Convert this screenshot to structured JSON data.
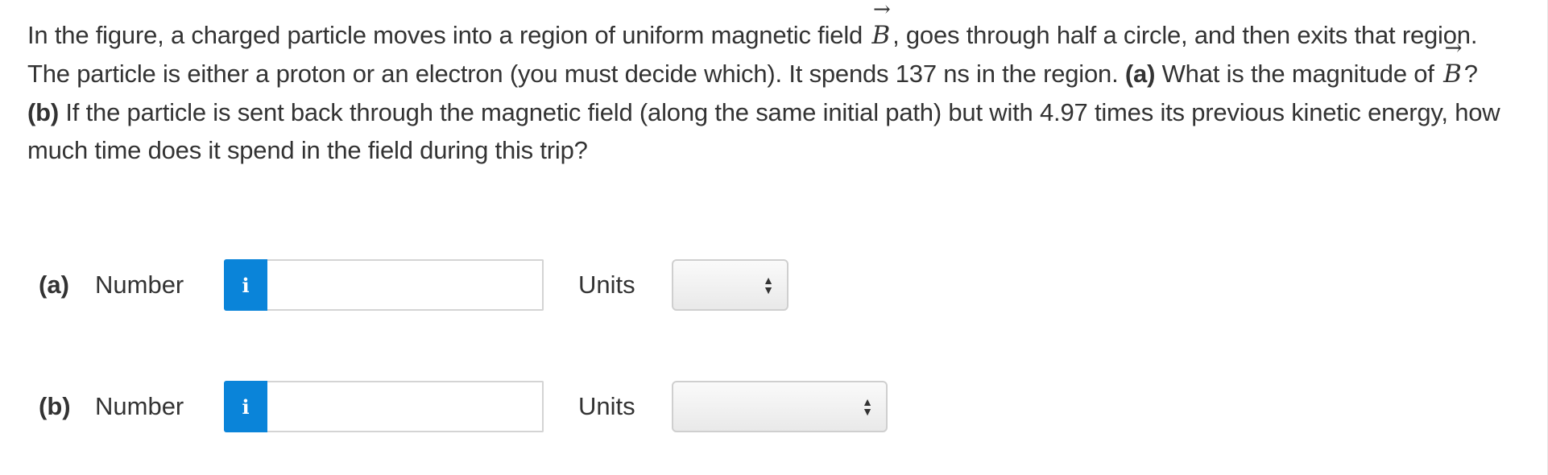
{
  "question": {
    "sentence1_a": "In the figure, a charged particle moves into a region of uniform magnetic field ",
    "vector_symbol": "B",
    "vector_arrow": "→",
    "sentence1_b": ", goes through half a circle, and then exits that region. The particle is either a proton or an electron (you must decide which). It spends 137 ns in the region. ",
    "part_a_label": "(a)",
    "part_a_text": " What is the magnitude of ",
    "part_a_end": "?",
    "part_b_label": "(b)",
    "part_b_text": " If the particle is sent back through the magnetic field (along the same initial path) but with 4.97 times its previous kinetic energy, how much time does it spend in the field during this trip?"
  },
  "answers": [
    {
      "part": "(a)",
      "number_label": "Number",
      "info_icon": "info-icon",
      "value": "",
      "units_label": "Units",
      "units_value": ""
    },
    {
      "part": "(b)",
      "number_label": "Number",
      "info_icon": "info-icon",
      "value": "",
      "units_label": "Units",
      "units_value": ""
    }
  ],
  "colors": {
    "info_button": "#0a84d9",
    "text": "#333333"
  }
}
